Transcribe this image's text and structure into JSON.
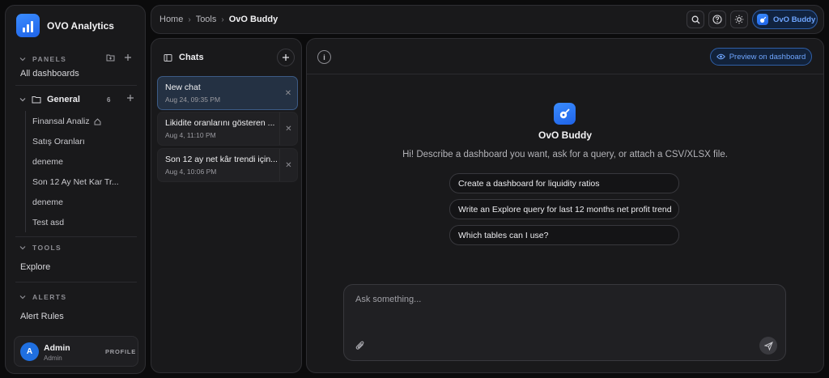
{
  "app": {
    "name": "OVO Analytics"
  },
  "sidebar": {
    "panels_label": "PANELS",
    "all_dashboards": "All dashboards",
    "folder": {
      "name": "General",
      "count": "6"
    },
    "folder_items": [
      "Finansal Analiz",
      "Satış Oranları",
      "deneme",
      "Son 12 Ay Net Kar Tr...",
      "deneme",
      "Test asd"
    ],
    "tools_label": "TOOLS",
    "explore": "Explore",
    "alerts_label": "ALERTS",
    "alert_rules": "Alert Rules",
    "profile": {
      "initial": "A",
      "name": "Admin",
      "role": "Admin",
      "link": "PROFILE"
    }
  },
  "topbar": {
    "breadcrumb": {
      "home": "Home",
      "tools": "Tools",
      "current": "OvO Buddy"
    },
    "buddy_label": "OvO Buddy"
  },
  "chats": {
    "title": "Chats",
    "items": [
      {
        "title": "New chat",
        "date": "Aug 24, 09:35 PM"
      },
      {
        "title": "Likidite oranlarını gösteren ...",
        "date": "Aug 4, 11:10 PM"
      },
      {
        "title": "Son 12 ay net kâr trendi için...",
        "date": "Aug 4, 10:06 PM"
      }
    ]
  },
  "main": {
    "preview_label": "Preview on dashboard",
    "title": "OvO Buddy",
    "subtitle": "Hi! Describe a dashboard you want, ask for a query, or attach a CSV/XLSX file.",
    "suggestions": [
      "Create a dashboard for liquidity ratios",
      "Write an Explore query for last 12 months net profit trend",
      "Which tables can I use?"
    ],
    "composer_placeholder": "Ask something..."
  },
  "colors": {
    "accent": "#1f6fe0",
    "accent_text": "#6fa6ff",
    "panel_bg": "#19191b",
    "active_chat_bg": "#243143"
  }
}
